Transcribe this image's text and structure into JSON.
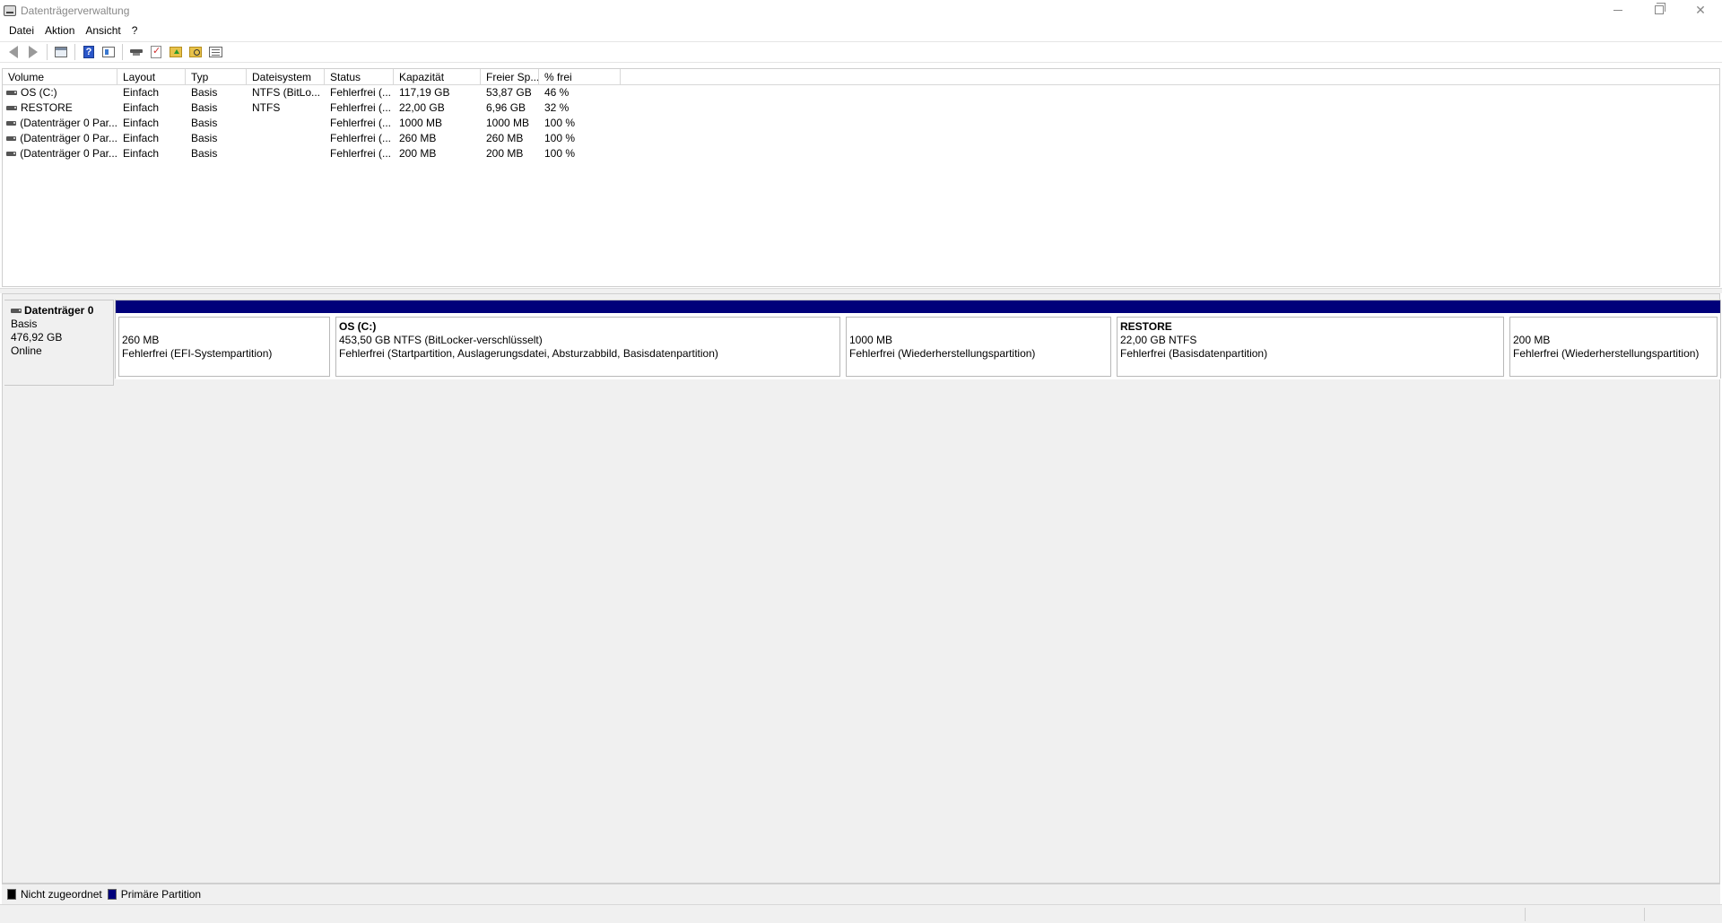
{
  "window": {
    "title": "Datenträgerverwaltung"
  },
  "menu": [
    "Datei",
    "Aktion",
    "Ansicht",
    "?"
  ],
  "toolbar": {
    "icons": [
      "back-icon",
      "forward-icon",
      "console-tree-icon",
      "help-icon",
      "properties-icon",
      "key-icon",
      "check-icon",
      "folder-up-icon",
      "folder-search-icon",
      "list-icon"
    ]
  },
  "volumes": {
    "columns": [
      "Volume",
      "Layout",
      "Typ",
      "Dateisystem",
      "Status",
      "Kapazität",
      "Freier Sp...",
      "% frei"
    ],
    "rows": [
      {
        "volume": "OS (C:)",
        "layout": "Einfach",
        "typ": "Basis",
        "fs": "NTFS (BitLo...",
        "status": "Fehlerfrei (...",
        "kap": "117,19 GB",
        "frei": "53,87 GB",
        "pct": "46 %"
      },
      {
        "volume": "RESTORE",
        "layout": "Einfach",
        "typ": "Basis",
        "fs": "NTFS",
        "status": "Fehlerfrei (...",
        "kap": "22,00 GB",
        "frei": "6,96 GB",
        "pct": "32 %"
      },
      {
        "volume": "(Datenträger 0 Par...",
        "layout": "Einfach",
        "typ": "Basis",
        "fs": "",
        "status": "Fehlerfrei (...",
        "kap": "1000 MB",
        "frei": "1000 MB",
        "pct": "100 %"
      },
      {
        "volume": "(Datenträger 0 Par...",
        "layout": "Einfach",
        "typ": "Basis",
        "fs": "",
        "status": "Fehlerfrei (...",
        "kap": "260 MB",
        "frei": "260 MB",
        "pct": "100 %"
      },
      {
        "volume": "(Datenträger 0 Par...",
        "layout": "Einfach",
        "typ": "Basis",
        "fs": "",
        "status": "Fehlerfrei (...",
        "kap": "200 MB",
        "frei": "200 MB",
        "pct": "100 %"
      }
    ]
  },
  "disk": {
    "name": "Datenträger 0",
    "type": "Basis",
    "size": "476,92 GB",
    "state": "Online",
    "partitions": [
      {
        "name": "",
        "size": "260 MB",
        "status": "Fehlerfrei (EFI-Systempartition)"
      },
      {
        "name": "OS  (C:)",
        "size": "453,50 GB NTFS (BitLocker-verschlüsselt)",
        "status": "Fehlerfrei (Startpartition, Auslagerungsdatei, Absturzabbild, Basisdatenpartition)"
      },
      {
        "name": "",
        "size": "1000 MB",
        "status": "Fehlerfrei (Wiederherstellungspartition)"
      },
      {
        "name": "RESTORE",
        "size": "22,00 GB NTFS",
        "status": "Fehlerfrei (Basisdatenpartition)"
      },
      {
        "name": "",
        "size": "200 MB",
        "status": "Fehlerfrei (Wiederherstellungspartition)"
      }
    ]
  },
  "legend": [
    {
      "label": "Nicht zugeordnet",
      "color": "#000000"
    },
    {
      "label": "Primäre Partition",
      "color": "#00007a"
    }
  ]
}
